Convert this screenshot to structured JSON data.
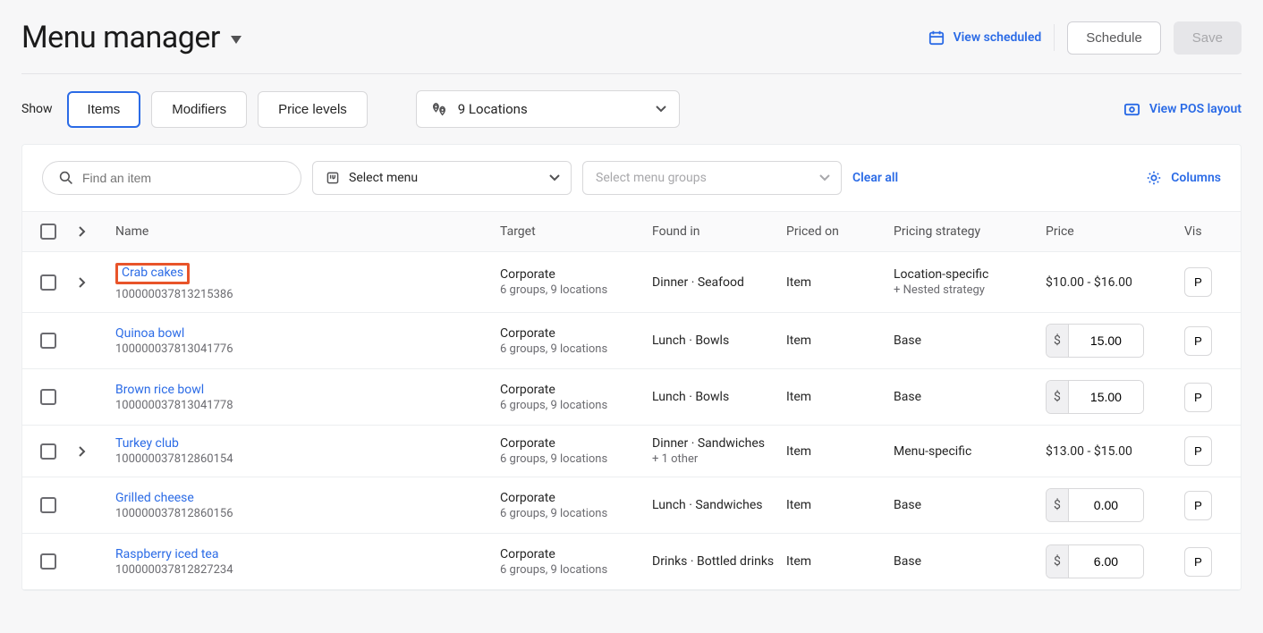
{
  "page": {
    "title": "Menu manager"
  },
  "header": {
    "view_scheduled": "View scheduled",
    "schedule": "Schedule",
    "save": "Save"
  },
  "filter": {
    "show_label": "Show",
    "tabs": {
      "items": "Items",
      "modifiers": "Modifiers",
      "price_levels": "Price levels"
    },
    "locations": "9 Locations",
    "view_pos_layout": "View POS layout"
  },
  "toolbar": {
    "search_placeholder": "Find an item",
    "select_menu": "Select menu",
    "select_menu_groups": "Select menu groups",
    "clear_all": "Clear all",
    "columns": "Columns"
  },
  "table": {
    "headers": {
      "name": "Name",
      "target": "Target",
      "found_in": "Found in",
      "priced_on": "Priced on",
      "pricing_strategy": "Pricing strategy",
      "price": "Price",
      "vis": "Vis"
    },
    "rows": [
      {
        "name": "Crab cakes",
        "id": "100000037813215386",
        "highlighted": true,
        "expandable": true,
        "target1": "Corporate",
        "target2": "6 groups, 9 locations",
        "found_in": "Dinner · Seafood",
        "priced_on": "Item",
        "strategy1": "Location-specific",
        "strategy2": "+ Nested strategy",
        "price_type": "text",
        "price": "$10.00 - $16.00",
        "vis": "P"
      },
      {
        "name": "Quinoa bowl",
        "id": "100000037813041776",
        "expandable": false,
        "target1": "Corporate",
        "target2": "6 groups, 9 locations",
        "found_in": "Lunch · Bowls",
        "priced_on": "Item",
        "strategy1": "Base",
        "price_type": "input",
        "price": "15.00",
        "vis": "P"
      },
      {
        "name": "Brown rice bowl",
        "id": "100000037813041778",
        "expandable": false,
        "target1": "Corporate",
        "target2": "6 groups, 9 locations",
        "found_in": "Lunch · Bowls",
        "priced_on": "Item",
        "strategy1": "Base",
        "price_type": "input",
        "price": "15.00",
        "vis": "P"
      },
      {
        "name": "Turkey club",
        "id": "100000037812860154",
        "expandable": true,
        "target1": "Corporate",
        "target2": "6 groups, 9 locations",
        "found_in": "Dinner · Sandwiches",
        "found_in2": "+ 1 other",
        "priced_on": "Item",
        "strategy1": "Menu-specific",
        "price_type": "text",
        "price": "$13.00 - $15.00",
        "vis": "P"
      },
      {
        "name": "Grilled cheese",
        "id": "100000037812860156",
        "expandable": false,
        "target1": "Corporate",
        "target2": "6 groups, 9 locations",
        "found_in": "Lunch · Sandwiches",
        "priced_on": "Item",
        "strategy1": "Base",
        "price_type": "input",
        "price": "0.00",
        "vis": "P"
      },
      {
        "name": "Raspberry iced tea",
        "id": "100000037812827234",
        "expandable": false,
        "target1": "Corporate",
        "target2": "6 groups, 9 locations",
        "found_in": "Drinks · Bottled drinks",
        "priced_on": "Item",
        "strategy1": "Base",
        "price_type": "input",
        "price": "6.00",
        "vis": "P"
      }
    ]
  },
  "currency_symbol": "$"
}
